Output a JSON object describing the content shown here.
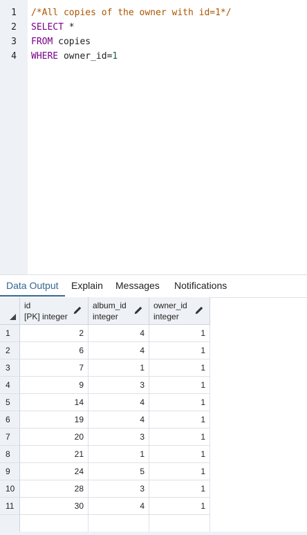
{
  "editor": {
    "lines": [
      {
        "num": "1",
        "tokens": [
          {
            "t": "/*All copies of the owner with id=1*/",
            "c": "comment"
          }
        ]
      },
      {
        "num": "2",
        "tokens": [
          {
            "t": "SELECT",
            "c": "keyword"
          },
          {
            "t": " *",
            "c": "plain"
          }
        ]
      },
      {
        "num": "3",
        "tokens": [
          {
            "t": "FROM",
            "c": "keyword"
          },
          {
            "t": " copies",
            "c": "plain"
          }
        ]
      },
      {
        "num": "4",
        "tokens": [
          {
            "t": "WHERE",
            "c": "keyword"
          },
          {
            "t": " owner_id=",
            "c": "plain"
          },
          {
            "t": "1",
            "c": "number"
          }
        ]
      }
    ]
  },
  "tabs": [
    {
      "label": "Data Output",
      "active": true
    },
    {
      "label": "Explain",
      "active": false
    },
    {
      "label": "Messages",
      "active": false
    },
    {
      "label": "Notifications",
      "active": false
    }
  ],
  "grid": {
    "columns": [
      {
        "name": "id",
        "type": "[PK] integer",
        "icon": "pencil-icon"
      },
      {
        "name": "album_id",
        "type": "integer",
        "icon": "pencil-icon"
      },
      {
        "name": "owner_id",
        "type": "integer",
        "icon": "pencil-icon"
      }
    ],
    "rows": [
      {
        "n": "1",
        "cells": [
          "2",
          "4",
          "1"
        ]
      },
      {
        "n": "2",
        "cells": [
          "6",
          "4",
          "1"
        ]
      },
      {
        "n": "3",
        "cells": [
          "7",
          "1",
          "1"
        ]
      },
      {
        "n": "4",
        "cells": [
          "9",
          "3",
          "1"
        ]
      },
      {
        "n": "5",
        "cells": [
          "14",
          "4",
          "1"
        ]
      },
      {
        "n": "6",
        "cells": [
          "19",
          "4",
          "1"
        ]
      },
      {
        "n": "7",
        "cells": [
          "20",
          "3",
          "1"
        ]
      },
      {
        "n": "8",
        "cells": [
          "21",
          "1",
          "1"
        ]
      },
      {
        "n": "9",
        "cells": [
          "24",
          "5",
          "1"
        ]
      },
      {
        "n": "10",
        "cells": [
          "28",
          "3",
          "1"
        ]
      },
      {
        "n": "11",
        "cells": [
          "30",
          "4",
          "1"
        ]
      }
    ]
  },
  "colors": {
    "accent": "#326690",
    "comment": "#aa5500",
    "keyword": "#770088",
    "number": "#116644",
    "gutter": "#eef1f5"
  }
}
